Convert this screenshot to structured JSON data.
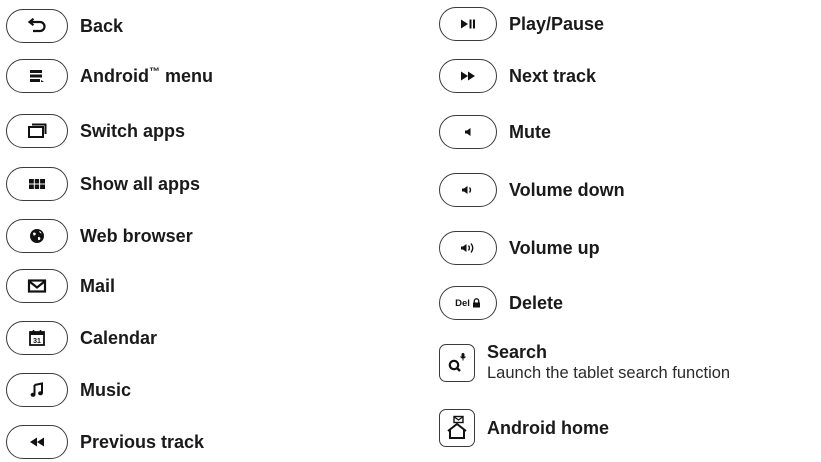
{
  "left_keys": [
    {
      "label": "Back",
      "icon": "back-arrow-icon"
    },
    {
      "label": "Android",
      "tm": "™",
      "label_suffix": " menu",
      "icon": "menu-icon"
    },
    {
      "label": "Switch apps",
      "icon": "switch-apps-icon"
    },
    {
      "label": "Show all apps",
      "icon": "grid-icon"
    },
    {
      "label": "Web browser",
      "icon": "globe-icon"
    },
    {
      "label": "Mail",
      "icon": "envelope-icon"
    },
    {
      "label": "Calendar",
      "icon": "calendar-icon",
      "icon_text": "31"
    },
    {
      "label": "Music",
      "icon": "music-note-icon"
    },
    {
      "label": "Previous track",
      "icon": "rewind-icon"
    }
  ],
  "right_keys": [
    {
      "label": "Play/Pause",
      "icon": "play-pause-icon"
    },
    {
      "label": "Next track",
      "icon": "fast-forward-icon"
    },
    {
      "label": "Mute",
      "icon": "speaker-icon"
    },
    {
      "label": "Volume down",
      "icon": "volume-down-icon"
    },
    {
      "label": "Volume up",
      "icon": "volume-up-icon"
    },
    {
      "label": "Delete",
      "icon": "lock-icon",
      "key_text": "Del"
    },
    {
      "label": "Search",
      "description": "Launch the tablet search function",
      "icon": "search-mic-icon"
    },
    {
      "label": "Android home",
      "icon": "home-mail-icon"
    }
  ]
}
